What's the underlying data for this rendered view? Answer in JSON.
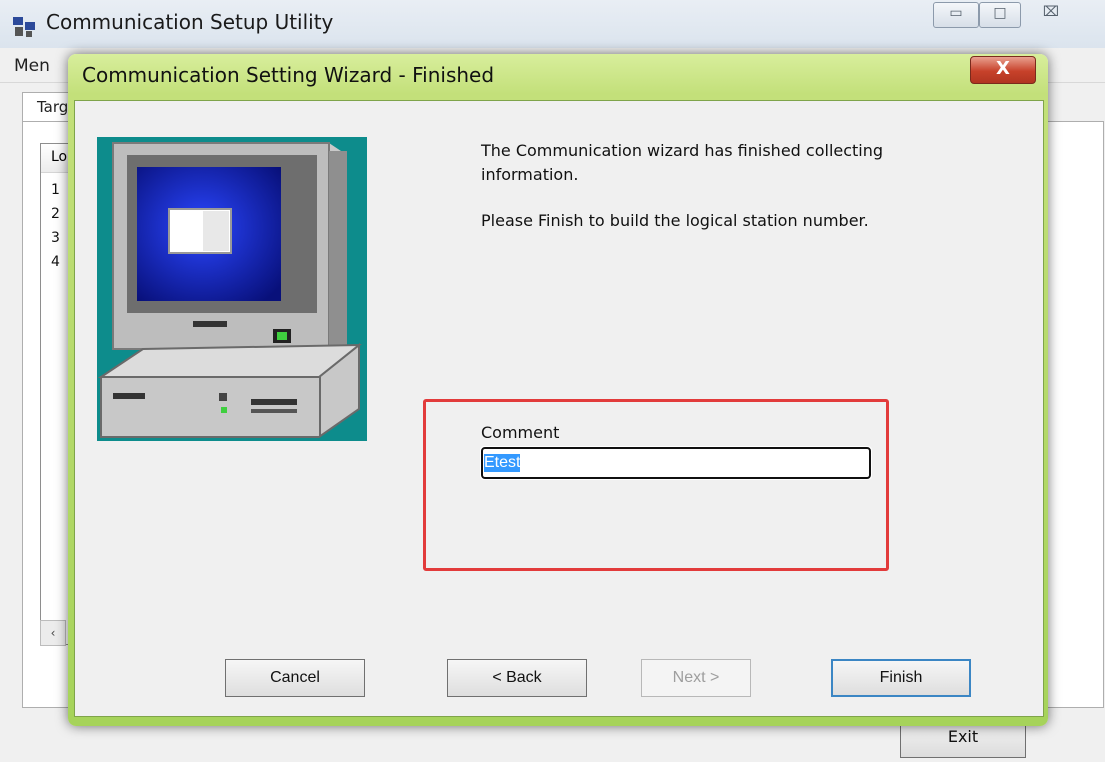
{
  "main_window": {
    "title": "Communication Setup Utility",
    "menu_label": "Men",
    "tab_label": "Targ",
    "list_header": "Lo",
    "list_rows": [
      "1",
      "2",
      "3",
      "4"
    ],
    "scroll_left_glyph": "‹",
    "exit_label": "Exit",
    "caption": {
      "minimize_glyph": "▭",
      "maximize_glyph": "□",
      "close_glyph": "⌧"
    }
  },
  "wizard": {
    "title": "Communication Setting Wizard - Finished",
    "close_glyph": "X",
    "info_line1": "The Communication wizard has finished collecting information.",
    "info_line2": "Please Finish to build the logical station number.",
    "comment_label": "Comment",
    "comment_value": "Etest",
    "buttons": {
      "cancel": "Cancel",
      "back": "< Back",
      "next": "Next >",
      "finish": "Finish"
    }
  },
  "colors": {
    "dialog_frame": "#a6d35a",
    "highlight_border": "#e23b3b",
    "selection": "#3399ff",
    "illustration_bg": "#0d8c8c",
    "screen_blue": "#1428c8"
  }
}
